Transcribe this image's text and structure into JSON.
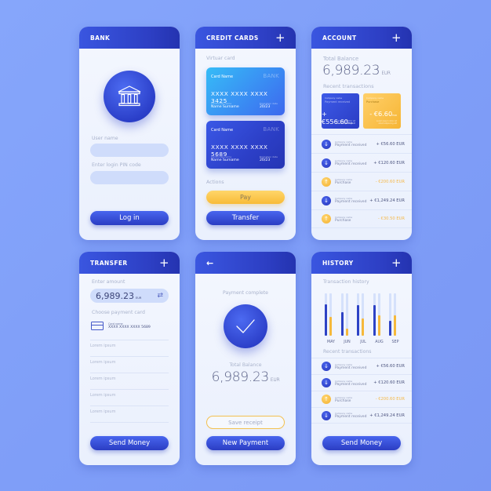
{
  "colors": {
    "background": "#8aa5fb",
    "primary": "#2d3fc4",
    "accent": "#f6b93b",
    "screen_bg": "#f2f6fe"
  },
  "bank": {
    "title": "BANK",
    "icon": "bank-building-icon",
    "username_label": "User name",
    "username_value": "",
    "pin_label": "Enter login PIN code",
    "pin_value": "",
    "login_button": "Log in"
  },
  "credit_cards": {
    "title": "CREDIT CARDS",
    "add_icon": "plus-icon",
    "section_label": "Virtuar card",
    "cards": [
      {
        "card_name": "Card Name",
        "bank": "BANK",
        "number": "XXXX XXXX XXXX 3425",
        "holder_label": "Cardholder name",
        "holder": "Name Surname",
        "expiry_label": "Expiration date",
        "expiry": "20/23"
      },
      {
        "card_name": "Card Name",
        "bank": "BANK",
        "number": "XXXX XXXX XXXX 5689",
        "holder_label": "Cardholder name",
        "holder": "Name Surname",
        "expiry_label": "Expiration date",
        "expiry": "20/23"
      }
    ],
    "actions_label": "Actions",
    "pay_button": "Pay",
    "transfer_button": "Transfer"
  },
  "account": {
    "title": "ACCOUNT",
    "add_icon": "plus-icon",
    "balance_label": "Total Balance",
    "balance": "6,989.23",
    "currency": "EUR",
    "recent_label": "Recent transactions",
    "tiles": [
      {
        "company": "Company name",
        "type": "Payment received",
        "amount": "+ €556.60",
        "currency": "EUR",
        "footnote": "Lorem ipsum dolor sit amet adipiscing elit"
      },
      {
        "company": "Company name",
        "type": "Purchase",
        "amount": "- €6.60",
        "currency": "EUR",
        "footnote": "Lorem ipsum dolor sit amet adipiscing elit"
      }
    ],
    "transactions": [
      {
        "direction": "in",
        "icon": "arrow-down-icon",
        "company": "Company name",
        "type": "Payment received",
        "amount": "+ €56.60 EUR"
      },
      {
        "direction": "in",
        "icon": "arrow-down-icon",
        "company": "Company name",
        "type": "Payment received",
        "amount": "+ €120.60 EUR"
      },
      {
        "direction": "out",
        "icon": "arrow-up-icon",
        "company": "Company name",
        "type": "Purchase",
        "amount": "- €200.60 EUR"
      },
      {
        "direction": "in",
        "icon": "arrow-down-icon",
        "company": "Company name",
        "type": "Payment received",
        "amount": "+ €1,249.24 EUR"
      },
      {
        "direction": "out",
        "icon": "arrow-up-icon",
        "company": "Company name",
        "type": "Purchase",
        "amount": "- €30.50 EUR"
      }
    ]
  },
  "transfer": {
    "title": "TRANSFER",
    "add_icon": "plus-icon",
    "amount_label": "Enter amount",
    "amount": "6,989.23",
    "currency": "EUR",
    "swap_icon": "swap-arrows-icon",
    "card_label": "Choose payment card",
    "card_name": "Card name",
    "card_number": "XXXX XXXX XXXX 5689",
    "fields": [
      "Lorem ipsum",
      "Lorem ipsum",
      "Lorem ipsum",
      "Lorem ipsum",
      "Lorem ipsum"
    ],
    "send_button": "Send Money"
  },
  "payment_complete": {
    "back_icon": "arrow-left-icon",
    "status": "Payment complete",
    "balance_label": "Total Balance",
    "balance": "6,989.23",
    "currency": "EUR",
    "save_button": "Save receipt",
    "new_payment_button": "New Payment"
  },
  "history": {
    "title": "HISTORY",
    "add_icon": "plus-icon",
    "chart_label": "Transaction history",
    "recent_label": "Recent transactions",
    "transactions": [
      {
        "direction": "in",
        "icon": "arrow-down-icon",
        "company": "Company name",
        "type": "Payment received",
        "amount": "+ €56.60 EUR"
      },
      {
        "direction": "in",
        "icon": "arrow-down-icon",
        "company": "Company name",
        "type": "Payment received",
        "amount": "+ €120.60 EUR"
      },
      {
        "direction": "out",
        "icon": "arrow-up-icon",
        "company": "Company name",
        "type": "Purchase",
        "amount": "- €200.60 EUR"
      },
      {
        "direction": "in",
        "icon": "arrow-down-icon",
        "company": "Company name",
        "type": "Payment received",
        "amount": "+ €1,249.24 EUR"
      }
    ],
    "send_button": "Send Money"
  },
  "chart_data": {
    "type": "bar",
    "title": "Transaction history",
    "categories": [
      "MAY",
      "JUN",
      "JUL",
      "AUG",
      "SEP"
    ],
    "series": [
      {
        "name": "received",
        "color": "#2d42c5",
        "values": [
          0.75,
          0.56,
          0.73,
          0.73,
          0.36
        ]
      },
      {
        "name": "spent",
        "color": "#f6b93b",
        "values": [
          0.45,
          0.16,
          0.41,
          0.49,
          0.49
        ]
      }
    ],
    "ylim": [
      0,
      1
    ],
    "grid": false,
    "xlabel": "",
    "ylabel": ""
  }
}
